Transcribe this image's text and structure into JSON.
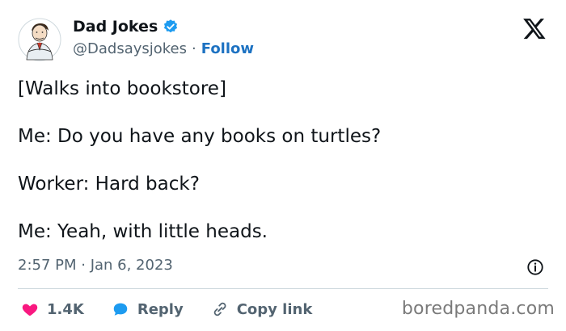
{
  "tweet": {
    "display_name": "Dad Jokes",
    "handle": "@Dadsaysjokes",
    "separator": "·",
    "follow_label": "Follow",
    "lines": [
      "[Walks into bookstore]",
      "Me: Do you have any books on turtles?",
      "Worker: Hard back?",
      "Me: Yeah, with little heads."
    ],
    "timestamp": "2:57 PM · Jan 6, 2023"
  },
  "actions": {
    "likes_count": "1.4K",
    "reply_label": "Reply",
    "copy_link_label": "Copy link"
  },
  "icons": {
    "brand": "x-logo-icon",
    "verified": "verified-badge-icon",
    "info": "info-icon",
    "like": "heart-icon",
    "reply": "reply-bubble-icon",
    "copy": "link-icon"
  },
  "colors": {
    "verified_blue": "#1d9bf0",
    "follow_blue": "#1d72c2",
    "like_pink": "#f91880",
    "secondary_text": "#536471"
  },
  "watermark": "boredpanda.com"
}
